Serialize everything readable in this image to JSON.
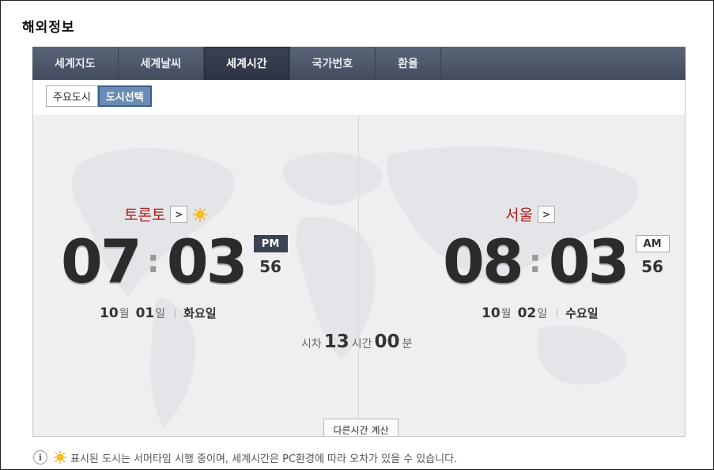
{
  "page_title": "해외정보",
  "tabs": [
    {
      "label": "세계지도",
      "active": false
    },
    {
      "label": "세계날씨",
      "active": false
    },
    {
      "label": "세계시간",
      "active": true
    },
    {
      "label": "국가번호",
      "active": false
    },
    {
      "label": "환율",
      "active": false
    }
  ],
  "subtabs": [
    {
      "label": "주요도시",
      "active": false
    },
    {
      "label": "도시선택",
      "active": true
    }
  ],
  "left": {
    "city": "토론토",
    "city_button": ">",
    "hours": "07",
    "minutes": "03",
    "ampm": "PM",
    "seconds": "56",
    "month": "10",
    "month_unit": "월",
    "day": "01",
    "day_unit": "일",
    "weekday": "화요일",
    "dst_icon": "sun-icon"
  },
  "right": {
    "city": "서울",
    "city_button": ">",
    "hours": "08",
    "minutes": "03",
    "ampm": "AM",
    "seconds": "56",
    "month": "10",
    "month_unit": "월",
    "day": "02",
    "day_unit": "일",
    "weekday": "수요일"
  },
  "difference": {
    "prefix": "시차",
    "hours": "13",
    "hours_unit": "시간",
    "minutes": "00",
    "minutes_unit": "분"
  },
  "calc_button": "다른시간 계산",
  "note": "표시된 도시는 서머타임 시행 중이며, 세계시간은 PC환경에 따라 오차가 있을 수 있습니다.",
  "colors": {
    "accent_red": "#b01c1c",
    "tab_bg": "#4b5467",
    "pm_bg": "#3c4354"
  }
}
